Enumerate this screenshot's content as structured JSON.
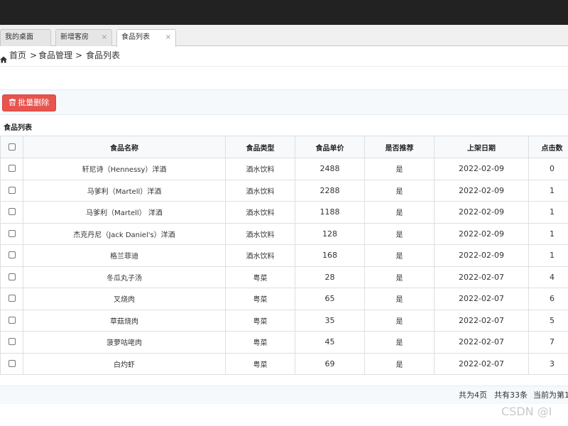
{
  "tabs": [
    {
      "label": "我的桌面",
      "closable": false,
      "active": false
    },
    {
      "label": "新增客房",
      "closable": true,
      "active": false
    },
    {
      "label": "食品列表",
      "closable": true,
      "active": true
    }
  ],
  "tab_close_glyph": "×",
  "breadcrumb": {
    "items": [
      "首页",
      "食品管理",
      "食品列表"
    ],
    "separator": ">"
  },
  "toolbar": {
    "batch_delete_label": "批量删除",
    "accent": "#e8534d"
  },
  "list_title": "食品列表",
  "table": {
    "columns": [
      "食品名称",
      "食品类型",
      "食品单价",
      "是否推荐",
      "上架日期",
      "点击数"
    ],
    "rows": [
      [
        "轩尼诗（Hennessy）洋酒",
        "酒水饮料",
        "2488",
        "是",
        "2022-02-09",
        "0"
      ],
      [
        "马爹利（Martell）洋酒",
        "酒水饮料",
        "2288",
        "是",
        "2022-02-09",
        "1"
      ],
      [
        "马爹利（Martell） 洋酒",
        "酒水饮料",
        "1188",
        "是",
        "2022-02-09",
        "1"
      ],
      [
        "杰克丹尼（Jack Daniel's）洋酒",
        "酒水饮料",
        "128",
        "是",
        "2022-02-09",
        "1"
      ],
      [
        "格兰菲迪",
        "酒水饮料",
        "168",
        "是",
        "2022-02-09",
        "1"
      ],
      [
        "冬瓜丸子汤",
        "粤菜",
        "28",
        "是",
        "2022-02-07",
        "4"
      ],
      [
        "叉烧肉",
        "粤菜",
        "65",
        "是",
        "2022-02-07",
        "6"
      ],
      [
        "草菇烧肉",
        "粤菜",
        "35",
        "是",
        "2022-02-07",
        "5"
      ],
      [
        "菠萝咕咾肉",
        "粤菜",
        "45",
        "是",
        "2022-02-07",
        "7"
      ],
      [
        "白灼虾",
        "粤菜",
        "69",
        "是",
        "2022-02-07",
        "3"
      ]
    ]
  },
  "pagination": {
    "total_pages": "共为4页",
    "total_records": "共有33条",
    "current_page": "当前为第1"
  },
  "watermark": "CSDN @I"
}
